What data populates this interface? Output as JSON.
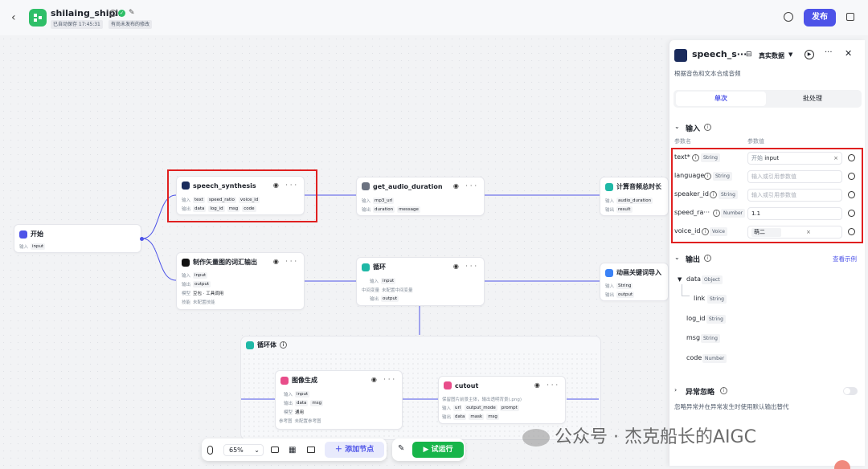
{
  "header": {
    "back_icon": "‹",
    "app_name": "shilaing_shipin",
    "autosave": "已自动保存 17:45:31",
    "unpublished": "有尚未发布的修改",
    "publish_label": "发布"
  },
  "nodes": {
    "start": {
      "title": "开始",
      "in_label": "输入",
      "in_chip": "input"
    },
    "speech": {
      "title": "speech_synthesis",
      "in_label": "输入",
      "out_label": "输出",
      "inputs": [
        "text",
        "speed_ratio",
        "voice_id"
      ],
      "outputs": [
        "data",
        "log_id",
        "msg",
        "code"
      ]
    },
    "audio": {
      "title": "get_audio_duration",
      "in_label": "输入",
      "out_label": "输出",
      "inputs": [
        "mp3_url"
      ],
      "outputs": [
        "duration",
        "message"
      ]
    },
    "calc": {
      "title": "计算音频总时长",
      "in_label": "输入",
      "out_label": "输出",
      "inputs": [
        "audio_duration"
      ],
      "outputs": [
        "result"
      ]
    },
    "vector": {
      "title": "制作矢量图的词汇输出",
      "in_label": "输入",
      "out_label": "输出",
      "model_label": "模型",
      "skill_label": "技能",
      "inputs": [
        "input"
      ],
      "outputs": [
        "output"
      ],
      "model": "豆包 · 工具调用",
      "skill": "未配置技能"
    },
    "loop": {
      "title": "循环",
      "in_label": "输入",
      "mid_label": "中间变量",
      "out_label": "输出",
      "inputs": [
        "input"
      ],
      "mid": "未配置中间变量",
      "outputs": [
        "output"
      ]
    },
    "anim": {
      "title": "动画关键词导入",
      "in_label": "输入",
      "out_label": "输出",
      "inputs": [
        "String"
      ],
      "outputs": [
        "output"
      ]
    },
    "loopbody": {
      "title": "循环体"
    },
    "imagegen": {
      "title": "图像生成",
      "in_label": "输入",
      "out_label": "输出",
      "model_label": "模型",
      "ref_label": "参考图",
      "inputs": [
        "input"
      ],
      "outputs": [
        "data",
        "msg"
      ],
      "model": "通用",
      "ref": "未配置参考图"
    },
    "cutout": {
      "title": "cutout",
      "desc": "保留图片前景主体，输出透明背景(.png)",
      "in_label": "输入",
      "out_label": "输出",
      "inputs": [
        "url",
        "output_mode",
        "prompt"
      ],
      "outputs": [
        "data",
        "mask",
        "msg"
      ]
    }
  },
  "toolbar": {
    "zoom": "65%",
    "add_node": "添加节点",
    "run": "试运行"
  },
  "panel": {
    "title": "speech_s···",
    "data_mode": "真实数据",
    "desc": "根据音色和文本合成音频",
    "tab_single": "单次",
    "tab_batch": "批处理",
    "input_title": "输入",
    "col_name": "参数名",
    "col_value": "参数值",
    "params": [
      {
        "name": "text*",
        "type": "String",
        "value": "input",
        "prefix": "开始",
        "placeholder": false
      },
      {
        "name": "language",
        "type": "String",
        "value": "输入或引用参数值",
        "prefix": "",
        "placeholder": true
      },
      {
        "name": "speaker_id",
        "type": "String",
        "value": "输入或引用参数值",
        "prefix": "",
        "placeholder": true
      },
      {
        "name": "speed_ra···",
        "type": "Number",
        "value": "1.1",
        "prefix": "",
        "placeholder": false
      },
      {
        "name": "voice_id",
        "type": "Voice",
        "value": "萌二",
        "prefix": "",
        "placeholder": false
      }
    ],
    "output_title": "输出",
    "view_example": "查看示例",
    "outputs": [
      {
        "name": "data",
        "type": "Object"
      },
      {
        "name": "link",
        "type": "String"
      },
      {
        "name": "log_id",
        "type": "String"
      },
      {
        "name": "msg",
        "type": "String"
      },
      {
        "name": "code",
        "type": "Number"
      }
    ],
    "exception_title": "异常忽略",
    "exception_desc": "忽略异常并在异常发生时使用默认输出替代"
  },
  "watermark": "公众号 · 杰克船长的AIGC",
  "colors": {
    "accent": "#4d53e8",
    "run": "#17b54a",
    "highlight": "#e02020"
  }
}
